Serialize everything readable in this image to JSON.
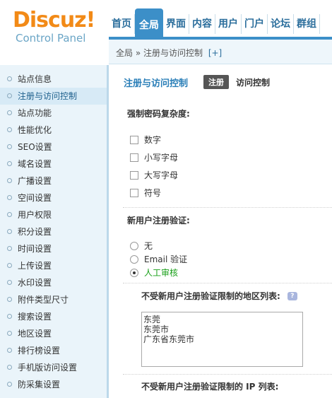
{
  "logo": {
    "main": "Discuz!",
    "sub": "Control Panel"
  },
  "topnav": {
    "tabs": [
      "首页",
      "全局",
      "界面",
      "内容",
      "用户",
      "门户",
      "论坛",
      "群组"
    ],
    "active": "全局"
  },
  "breadcrumb": {
    "path": "全局 » 注册与访问控制",
    "plus": "[+]"
  },
  "sidebar": {
    "items": [
      "站点信息",
      "注册与访问控制",
      "站点功能",
      "性能优化",
      "SEO设置",
      "域名设置",
      "广播设置",
      "空间设置",
      "用户权限",
      "积分设置",
      "时间设置",
      "上传设置",
      "水印设置",
      "附件类型尺寸",
      "搜索设置",
      "地区设置",
      "排行榜设置",
      "手机版访问设置",
      "防采集设置"
    ],
    "active_index": 1
  },
  "page": {
    "title": "注册与访问控制",
    "active_subtab": "注册",
    "other_subtab": "访问控制"
  },
  "password": {
    "label": "强制密码复杂度:",
    "options": [
      "数字",
      "小写字母",
      "大写字母",
      "符号"
    ]
  },
  "verify": {
    "label": "新用户注册验证:",
    "options": [
      "无",
      "Email 验证",
      "人工审核"
    ],
    "selected_index": 2
  },
  "region": {
    "label": "不受新用户注册验证限制的地区列表:",
    "lines": [
      "东莞",
      "东莞市",
      "广东省东莞市"
    ]
  },
  "ip": {
    "label": "不受新用户注册验证限制的 IP 列表:"
  },
  "colors": {
    "accent": "#3c8fc8",
    "logo": "#f28a17",
    "selected_option": "#1aa01a"
  }
}
